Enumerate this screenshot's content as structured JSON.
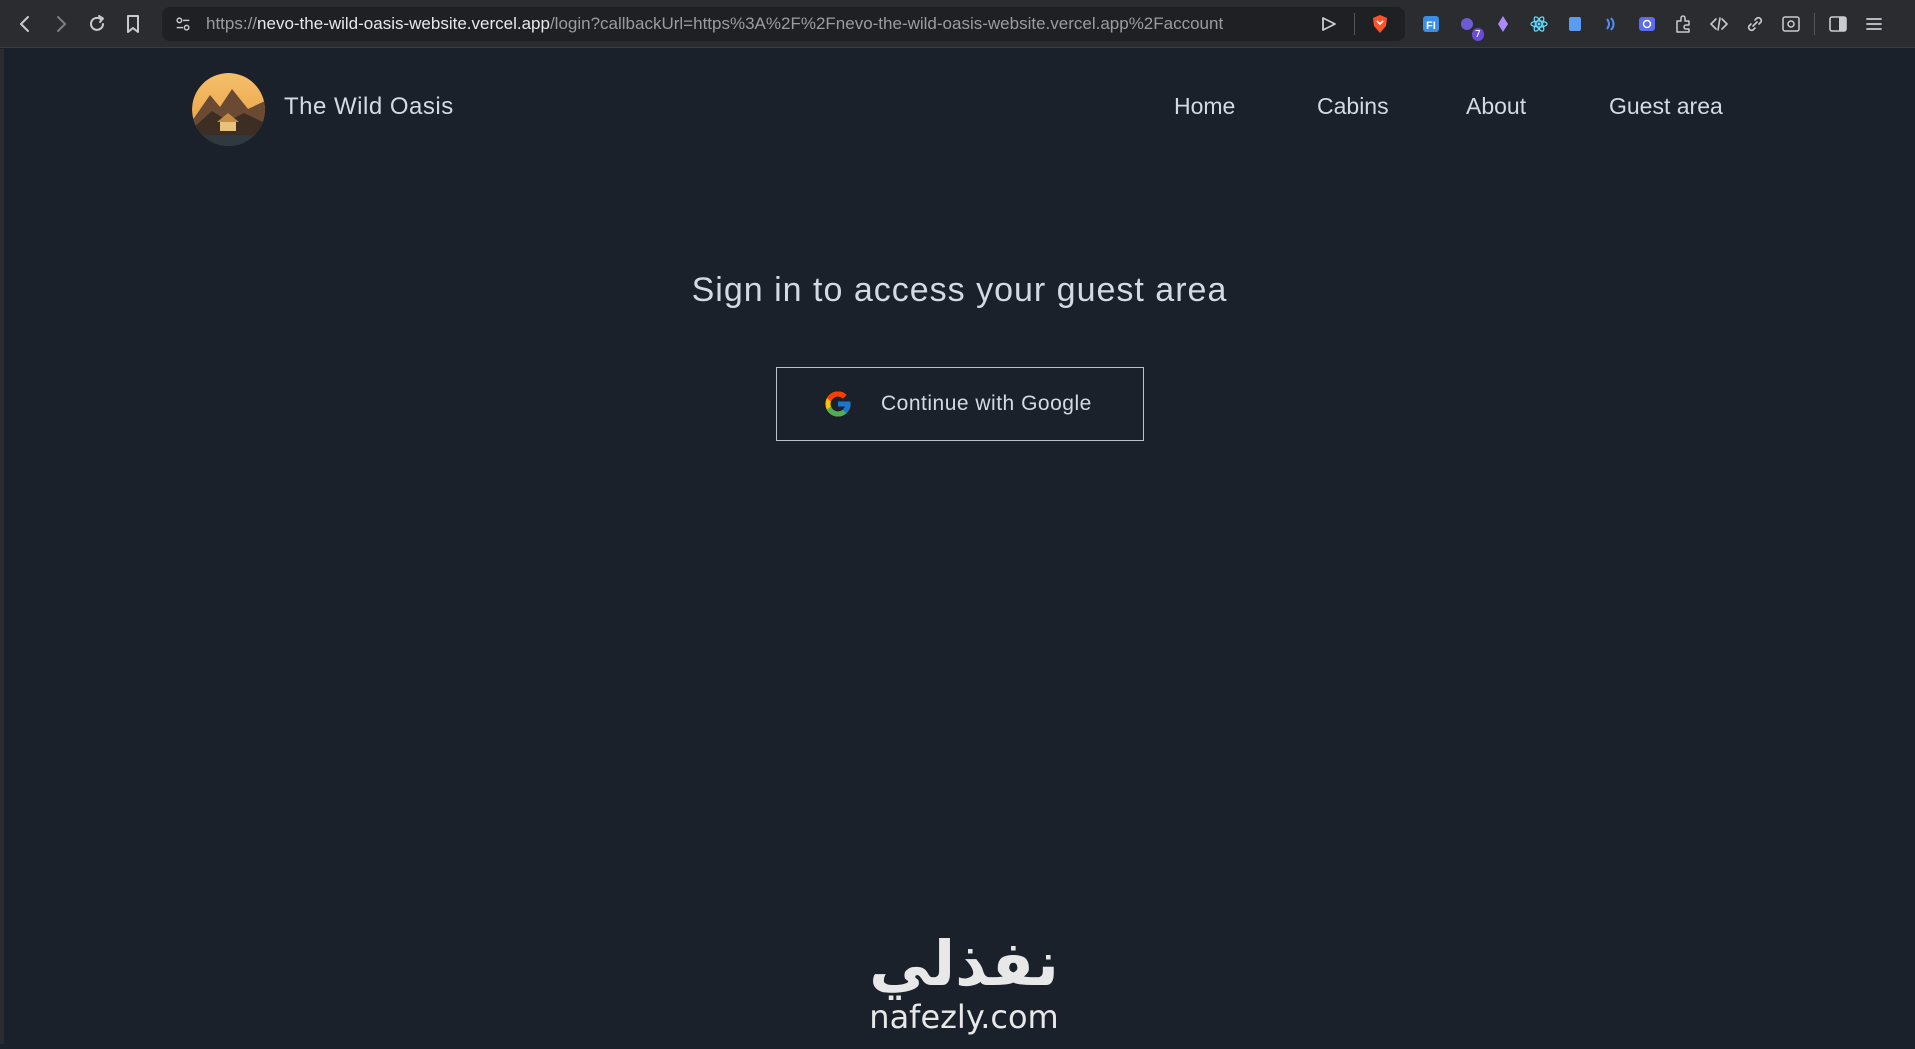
{
  "browser": {
    "url_scheme": "https://",
    "url_host": "nevo-the-wild-oasis-website.vercel.app",
    "url_path": "/login?callbackUrl=https%3A%2F%2Fnevo-the-wild-oasis-website.vercel.app%2Faccount",
    "extension_badge": "7",
    "icons": [
      "back-icon",
      "forward-icon",
      "reload-icon",
      "bookmark-icon",
      "site-settings-icon",
      "share-icon",
      "brave-shield-icon",
      "extensions-icon",
      "sidebar-icon",
      "menu-icon"
    ]
  },
  "header": {
    "brand": "The Wild Oasis",
    "nav": [
      "Home",
      "Cabins",
      "About",
      "Guest area"
    ]
  },
  "main": {
    "title": "Sign in to access your guest area",
    "google_button_label": "Continue with Google"
  },
  "watermark": {
    "arabic": "نفذلي",
    "latin": "nafezly.com"
  },
  "colors": {
    "background": "#1b212b",
    "text": "#d4dae2",
    "button_border": "#b9c1cc"
  }
}
